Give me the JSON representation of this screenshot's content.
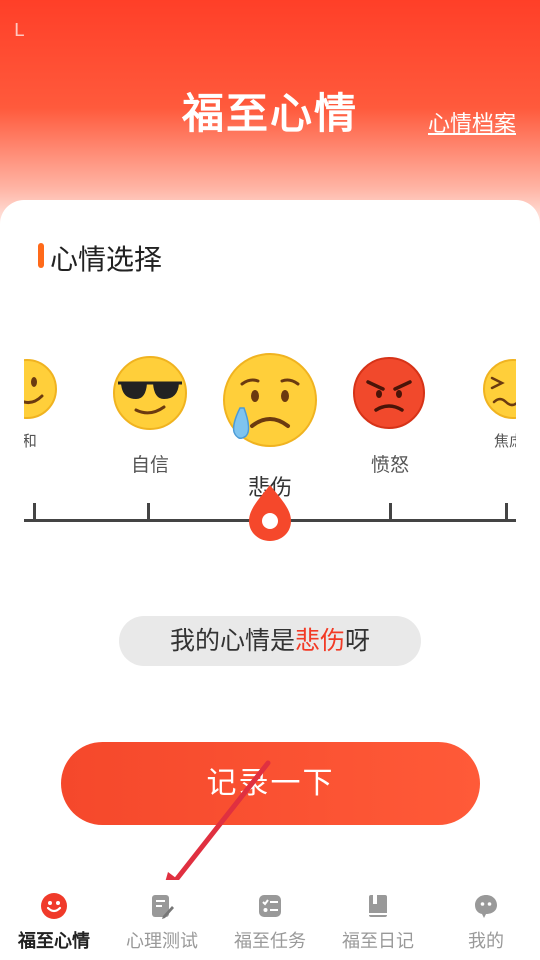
{
  "status_bar": {
    "indicator": "L"
  },
  "header": {
    "title": "福至心情",
    "archive_link": "心情档案"
  },
  "section": {
    "title": "心情选择"
  },
  "moods": [
    {
      "label": "平和",
      "display": "z和",
      "icon": "slight-smile-emoji-icon"
    },
    {
      "label": "自信",
      "icon": "sunglasses-emoji-icon"
    },
    {
      "label": "悲伤",
      "icon": "sad-tear-emoji-icon",
      "selected": true
    },
    {
      "label": "愤怒",
      "icon": "angry-emoji-icon"
    },
    {
      "label": "焦虑",
      "display": "焦虑",
      "icon": "anxious-emoji-icon"
    }
  ],
  "mood_result": {
    "prefix": "我的心情是",
    "mood": "悲伤",
    "suffix": "呀"
  },
  "record_button": {
    "label": "记录一下"
  },
  "tabs": [
    {
      "label": "福至心情",
      "icon": "smile-face-icon",
      "active": true
    },
    {
      "label": "心理测试",
      "icon": "edit-note-icon"
    },
    {
      "label": "福至任务",
      "icon": "task-list-icon"
    },
    {
      "label": "福至日记",
      "icon": "diary-book-icon"
    },
    {
      "label": "我的",
      "icon": "chat-bubble-icon"
    }
  ],
  "colors": {
    "primary": "#f5482b",
    "accent_bar": "#ff6a1a",
    "active_tab_icon": "#f03a2a",
    "arrow": "#e03040"
  }
}
